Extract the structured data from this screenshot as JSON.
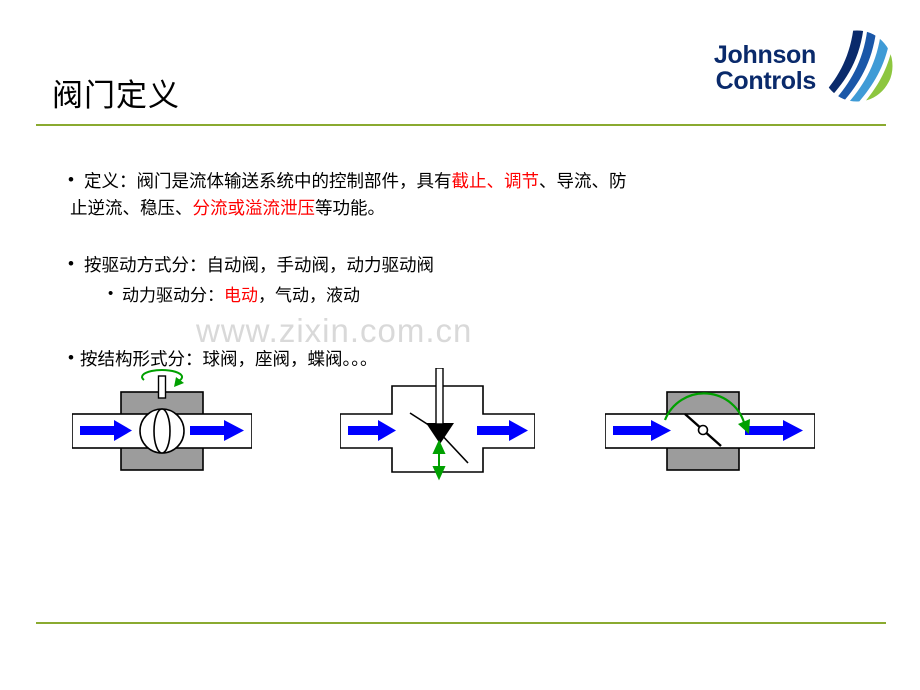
{
  "slide": {
    "title": "阀门定义",
    "brand": {
      "line1": "Johnson",
      "line2": "Controls",
      "logo_icon": "johnson-controls-swoosh-logo",
      "text_color": "#0a2a6b",
      "accent_color": "#8aaa30"
    },
    "rules": {
      "color": "#8aaa30"
    },
    "watermark": "www.zixin.com.cn",
    "body": {
      "para1": {
        "prefix": "定义：阀门是流体输送系统中的控制部件，具有",
        "highlight1": "截止、调节",
        "middle": "、导流、防",
        "line2_prefix": "止逆流、稳压、",
        "highlight2": "分流或溢流泄压",
        "line2_suffix": "等功能。"
      },
      "para2": {
        "main": "按驱动方式分：自动阀，手动阀，动力驱动阀",
        "sub_prefix": "动力驱动分：",
        "sub_highlight": "电动",
        "sub_suffix": "，气动，液动"
      },
      "para3": {
        "main": "按结构形式分：球阀，座阀，蝶阀。。。"
      },
      "highlight_color": "#ff0000"
    },
    "diagrams": [
      {
        "id": "ball-valve-diagram",
        "name": "球阀",
        "flow_arrow_color": "#0000ff",
        "actuator_arrow_color": "#00a000",
        "body_fill": "#9c9c9c"
      },
      {
        "id": "globe-valve-diagram",
        "name": "座阀",
        "flow_arrow_color": "#0000ff",
        "actuator_arrow_color": "#00a000",
        "body_fill": "#ffffff"
      },
      {
        "id": "butterfly-valve-diagram",
        "name": "蝶阀",
        "flow_arrow_color": "#0000ff",
        "actuator_arrow_color": "#00a000",
        "body_fill": "#9c9c9c"
      }
    ]
  }
}
